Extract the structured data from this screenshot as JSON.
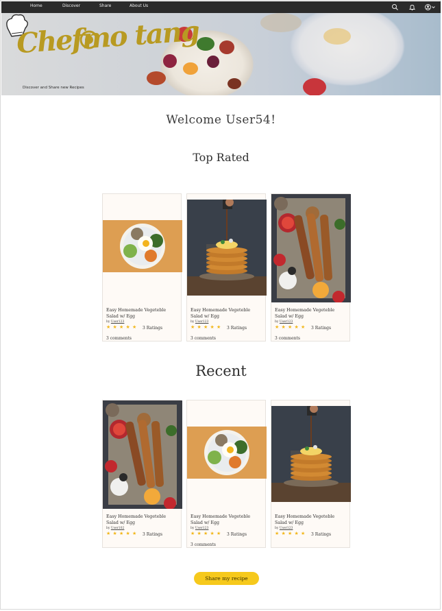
{
  "nav": {
    "items": [
      "Home",
      "Discover",
      "Share",
      "About Us"
    ],
    "icons": [
      "search-icon",
      "bell-icon",
      "user-account-icon"
    ]
  },
  "hero": {
    "logo_text": "Chefmo tang",
    "tagline": "Discover and Share new Recipes"
  },
  "welcome": "Welcome User54!",
  "sections": {
    "top_rated": "Top Rated",
    "recent": "Recent"
  },
  "top_rated_cards": [
    {
      "image": "egg-bowl",
      "title": "Easy Homemade Vegeteble Salad w/ Egg",
      "by": "by",
      "user": "User123",
      "rating": 5,
      "ratings_label": "3 Ratings",
      "comments": "3 comments"
    },
    {
      "image": "pancakes",
      "title": "Easy Homemade Vegeteble Salad w/ Egg",
      "by": "by",
      "user": "User123",
      "rating": 5,
      "ratings_label": "3 Ratings",
      "comments": "3 comments"
    },
    {
      "image": "skewers",
      "title": "Easy Homemade Vegeteble Salad w/ Egg",
      "by": "by",
      "user": "User123",
      "rating": 5,
      "ratings_label": "3 Ratings",
      "comments": "3 comments"
    }
  ],
  "recent_cards": [
    {
      "image": "skewers",
      "title": "Easy Homemade Vegeteble Salad w/ Egg",
      "by": "by",
      "user": "User102",
      "rating": 5,
      "ratings_label": "3 Ratings"
    },
    {
      "image": "egg-bowl",
      "title": "Easy Homemade Vegeteble Salad w/ Egg",
      "by": "by",
      "user": "User123",
      "rating": 5,
      "ratings_label": "3 Ratings",
      "comments": "3 comments"
    },
    {
      "image": "pancakes",
      "title": "Easy Homemade Vegeteble Salad w/ Egg",
      "by": "by",
      "user": "User123",
      "rating": 5,
      "ratings_label": "3 Ratings"
    }
  ],
  "share_button": "Share my recipe",
  "colors": {
    "nav_bg": "#2b2b2b",
    "accent": "#f6c91c",
    "logo_gold": "#b89a22",
    "star": "#f2b71b"
  }
}
